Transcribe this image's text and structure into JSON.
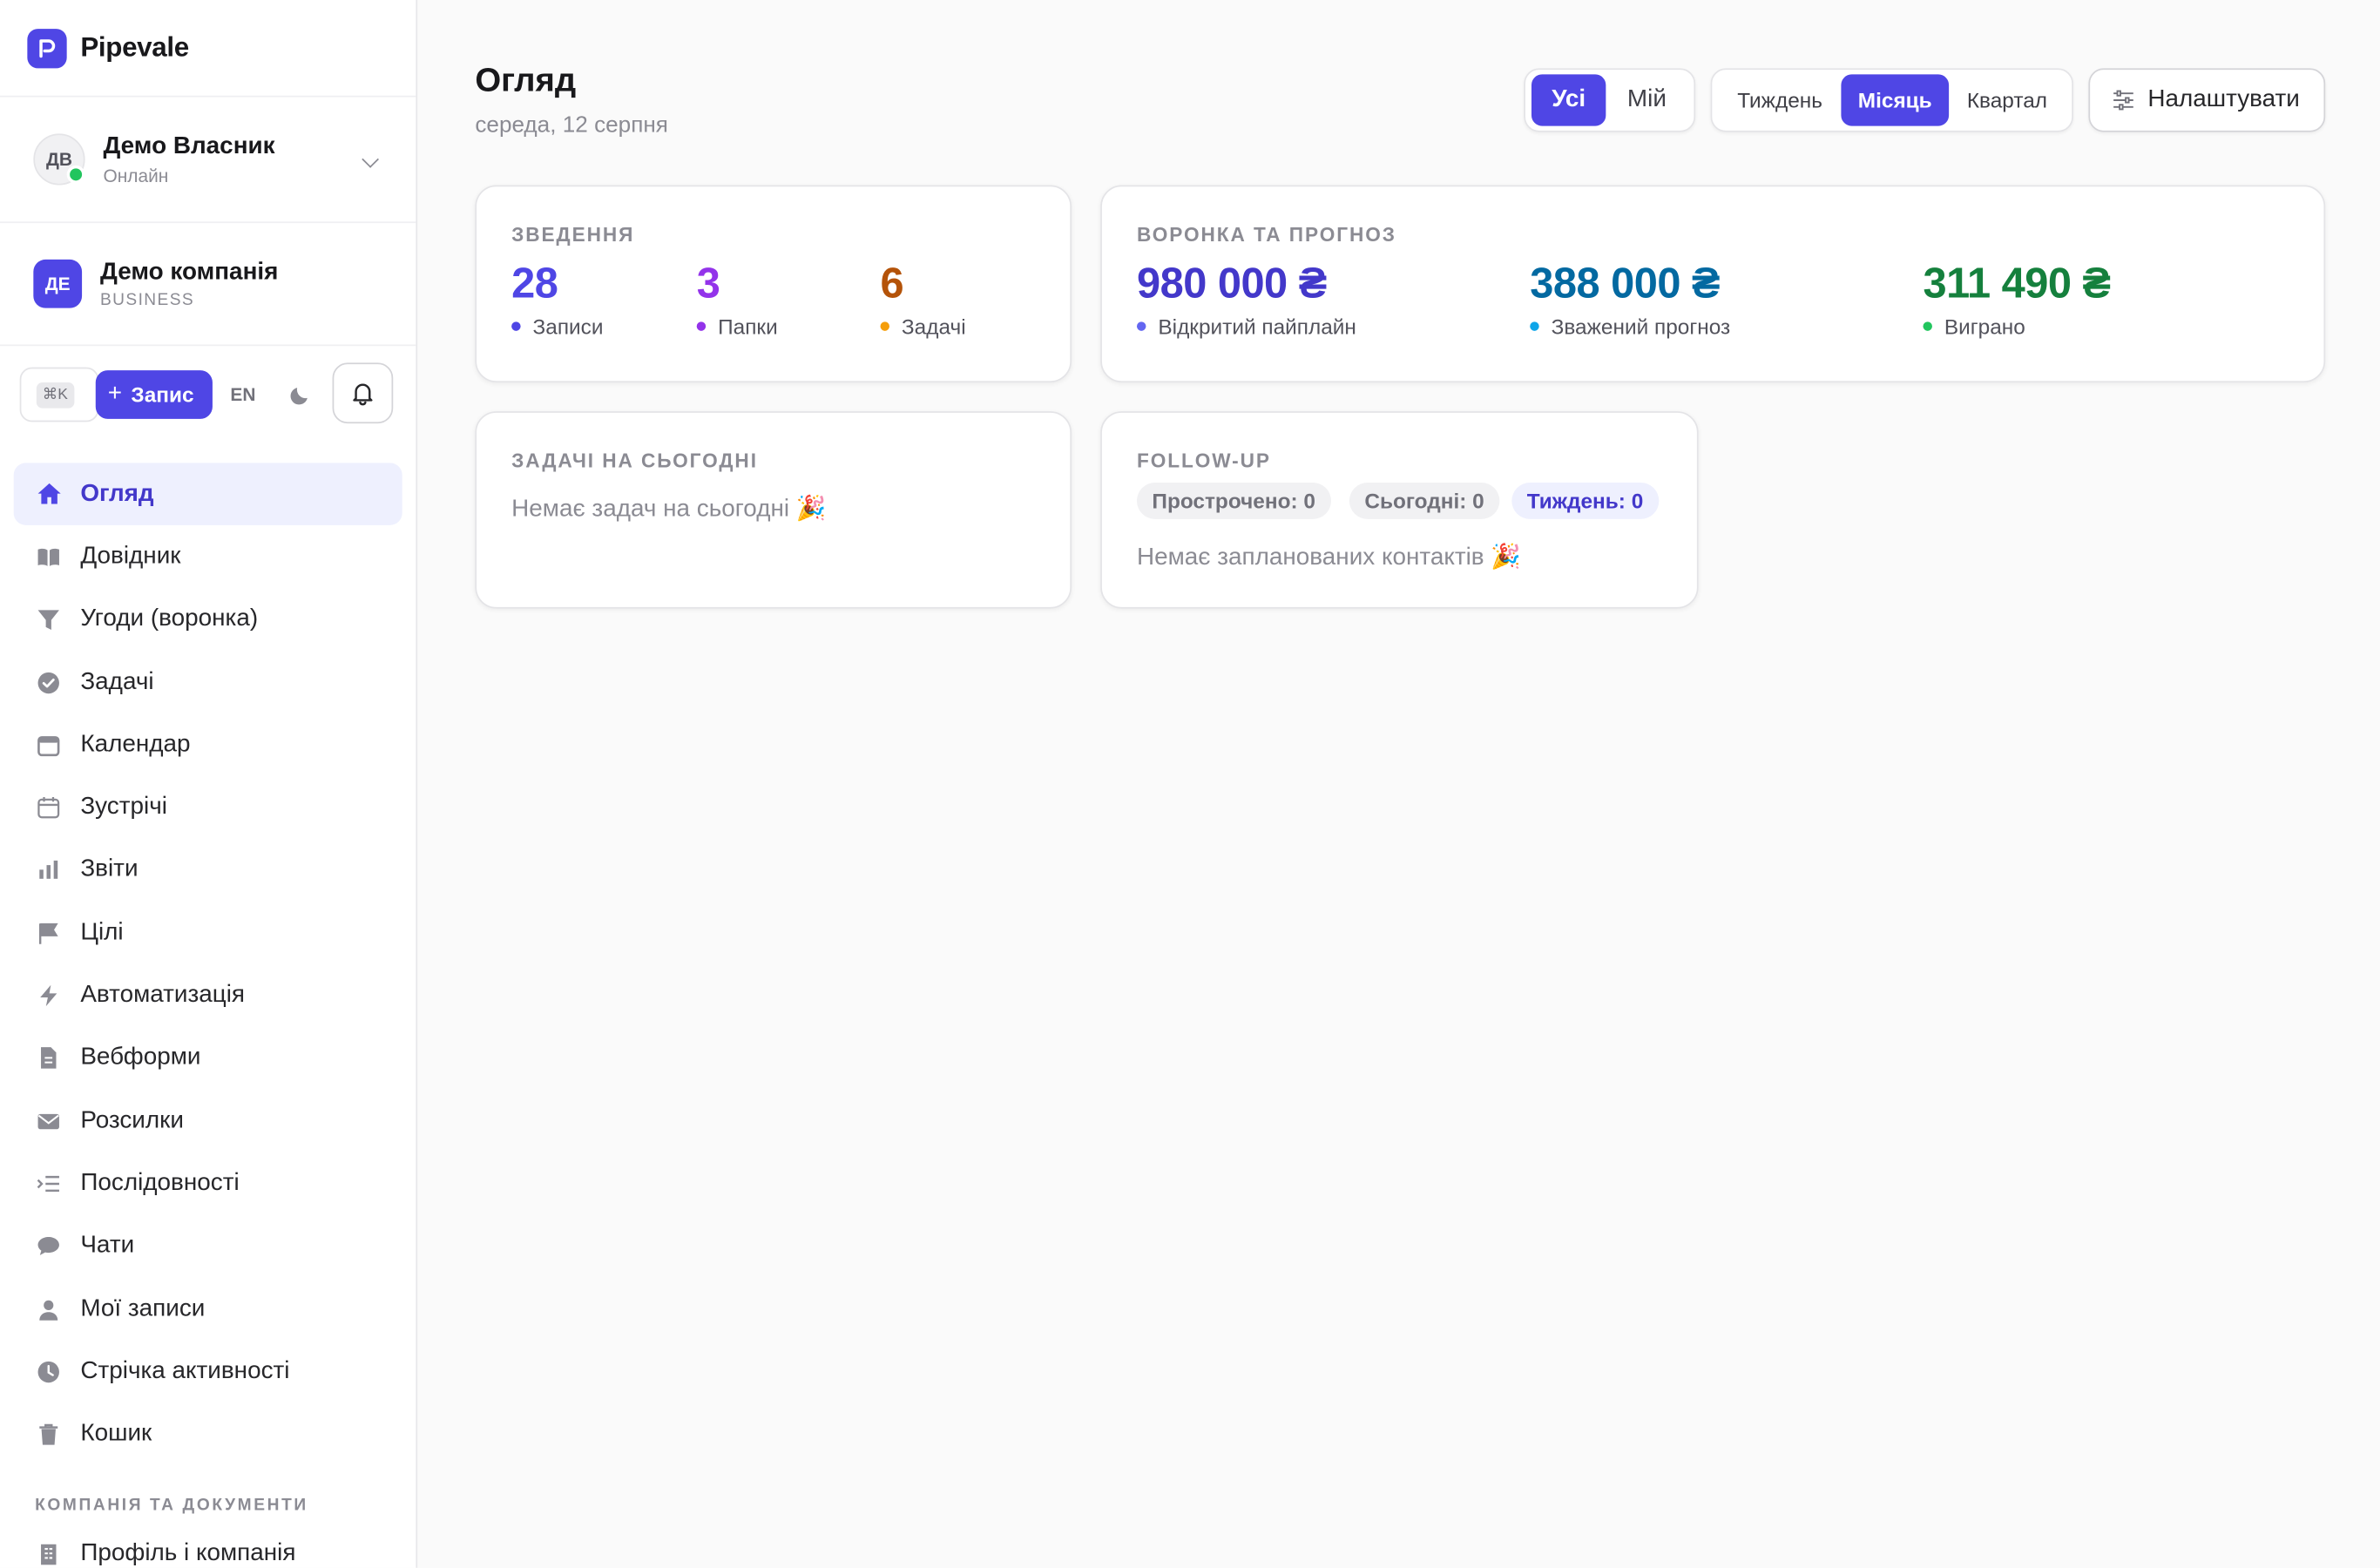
{
  "brand": {
    "name": "Pipevale"
  },
  "user": {
    "initials": "ДВ",
    "name": "Демо Власник",
    "status": "Онлайн"
  },
  "company": {
    "initials": "ДЕ",
    "name": "Демо компанія",
    "plan": "BUSINESS"
  },
  "toolbar": {
    "shortcut": "⌘K",
    "add_plus": "+",
    "add_label": "Запис",
    "language": "EN"
  },
  "nav": {
    "items": [
      {
        "label": "Огляд",
        "icon": "home-icon"
      },
      {
        "label": "Довідник",
        "icon": "book-icon"
      },
      {
        "label": "Угоди (воронка)",
        "icon": "funnel-icon"
      },
      {
        "label": "Задачі",
        "icon": "check-circle-icon"
      },
      {
        "label": "Календар",
        "icon": "calendar-icon"
      },
      {
        "label": "Зустрічі",
        "icon": "calendar-outline-icon"
      },
      {
        "label": "Звіти",
        "icon": "bar-chart-icon"
      },
      {
        "label": "Цілі",
        "icon": "flag-icon"
      },
      {
        "label": "Автоматизація",
        "icon": "bolt-icon"
      },
      {
        "label": "Вебформи",
        "icon": "document-icon"
      },
      {
        "label": "Розсилки",
        "icon": "envelope-icon"
      },
      {
        "label": "Послідовності",
        "icon": "list-indent-icon"
      },
      {
        "label": "Чати",
        "icon": "chat-bubble-icon"
      },
      {
        "label": "Мої записи",
        "icon": "user-icon"
      },
      {
        "label": "Стрічка активності",
        "icon": "clock-icon"
      },
      {
        "label": "Кошик",
        "icon": "trash-icon"
      }
    ],
    "section_label": "КОМПАНІЯ ТА ДОКУМЕНТИ",
    "section_items": [
      {
        "label": "Профіль і компанія",
        "icon": "building-icon"
      }
    ]
  },
  "header": {
    "title": "Огляд",
    "date": "середа, 12 серпня"
  },
  "scope_toggle": {
    "all": "Усі",
    "mine": "Мій",
    "selected": "Усі"
  },
  "period_toggle": {
    "week": "Тиждень",
    "month": "Місяць",
    "quarter": "Квартал",
    "selected": "Місяць"
  },
  "settings_button": {
    "label": "Налаштувати"
  },
  "summary": {
    "title": "ЗВЕДЕННЯ",
    "metrics": [
      {
        "value": "28",
        "label": "Записи",
        "color": "#4f46e5"
      },
      {
        "value": "3",
        "label": "Папки",
        "color": "#9333ea"
      },
      {
        "value": "6",
        "label": "Задачі",
        "color": "#b45309",
        "dot": "#f59e0b"
      }
    ]
  },
  "funnel": {
    "title": "ВОРОНКА ТА ПРОГНОЗ",
    "metrics": [
      {
        "value": "980 000 ₴",
        "label": "Відкритий пайплайн",
        "color": "#4338ca",
        "dot": "#6366f1"
      },
      {
        "value": "388 000 ₴",
        "label": "Зважений прогноз",
        "color": "#0369a1",
        "dot": "#0ea5e9"
      },
      {
        "value": "311 490 ₴",
        "label": "Виграно",
        "color": "#15803d",
        "dot": "#22c55e"
      }
    ]
  },
  "tasks_today": {
    "title": "ЗАДАЧІ НА СЬОГОДНІ",
    "empty": "Немає задач на сьогодні 🎉"
  },
  "followup": {
    "title": "FOLLOW-UP",
    "pills": {
      "overdue": "Прострочено: 0",
      "today": "Сьогодні: 0",
      "week": "Тиждень: 0"
    },
    "empty": "Немає запланованих контактів 🎉"
  }
}
